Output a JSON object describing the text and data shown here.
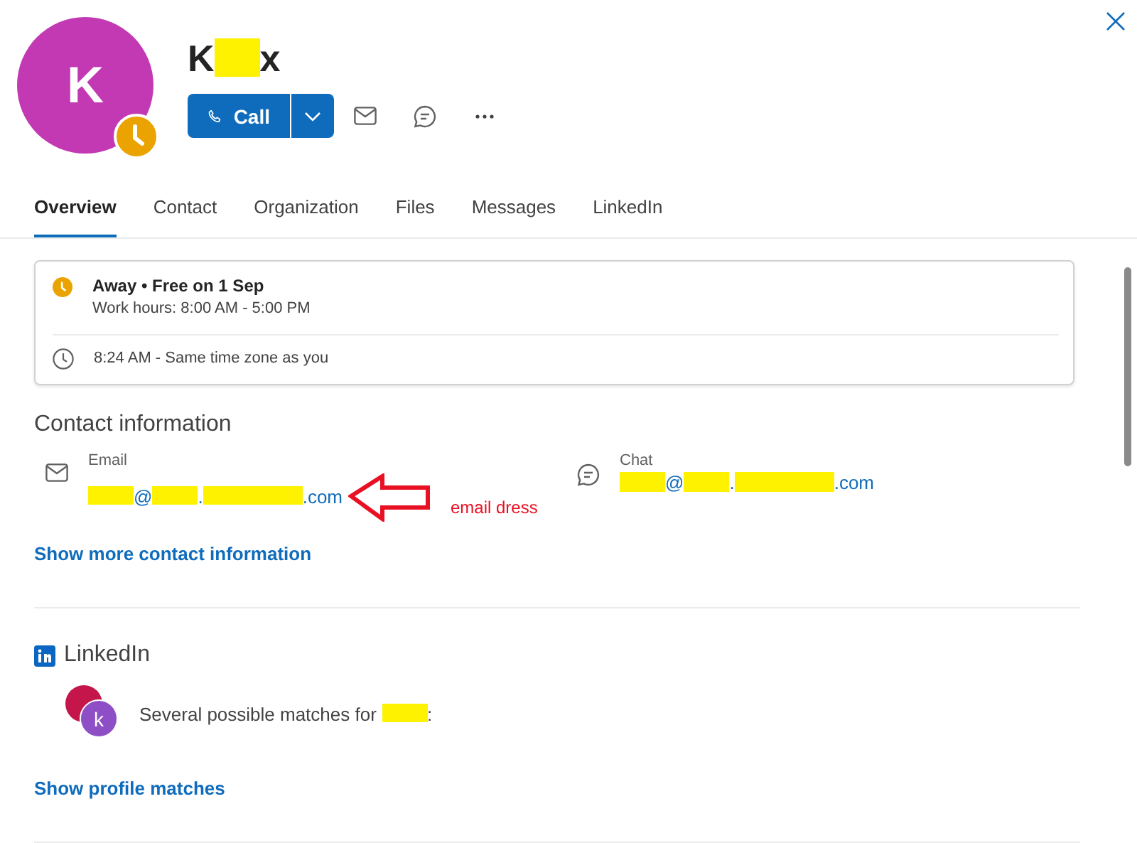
{
  "profile": {
    "initial": "K",
    "away": true,
    "name": [
      {
        "text": "K"
      },
      {
        "kind": "redaction",
        "wide": false
      },
      {
        "text": "x"
      }
    ]
  },
  "actions": {
    "call": "Call"
  },
  "tabs": [
    {
      "label": "Overview",
      "selected": true
    },
    {
      "label": "Contact",
      "selected": false
    },
    {
      "label": "Organization",
      "selected": false
    },
    {
      "label": "Files",
      "selected": false
    },
    {
      "label": "Messages",
      "selected": false
    },
    {
      "label": "LinkedIn",
      "selected": false
    }
  ],
  "status_card": {
    "away": true,
    "title": "Away • Free on 1 Sep",
    "work_hours": "Work hours: 8:00 AM - 5:00 PM",
    "local_time": "8:24 AM - Same time zone as you"
  },
  "contact_information": {
    "heading": "Contact information",
    "items": [
      {
        "kind": "email",
        "label": "Email",
        "value": [
          {
            "kind": "redaction",
            "wide": false
          },
          {
            "text": "@"
          },
          {
            "kind": "redaction",
            "wide": false
          },
          {
            "text": "."
          },
          {
            "kind": "redaction",
            "wide": true
          },
          {
            "text": ".com"
          }
        ]
      },
      {
        "kind": "chat",
        "label": "Chat",
        "value": [
          {
            "kind": "redaction",
            "wide": false
          },
          {
            "text": "@"
          },
          {
            "kind": "redaction",
            "wide": false
          },
          {
            "text": "."
          },
          {
            "kind": "redaction",
            "wide": true
          },
          {
            "text": ".com"
          }
        ]
      }
    ],
    "link": "Show more contact information"
  },
  "annotation": {
    "text": "email dress"
  },
  "linkedin": {
    "heading": "LinkedIn",
    "avatar_initial": "k",
    "message": [
      {
        "text": "Several possible matches for "
      },
      {
        "kind": "redaction",
        "wide": false
      },
      {
        "text": ":"
      }
    ],
    "link": "Show profile matches"
  }
}
